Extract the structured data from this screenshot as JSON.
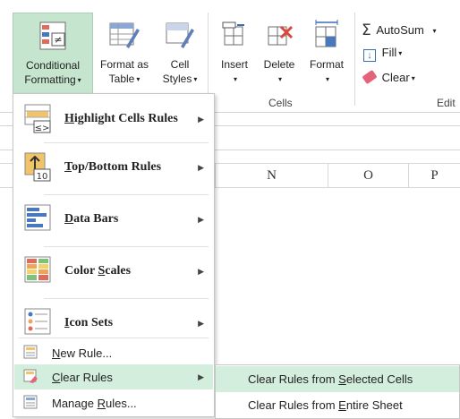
{
  "ribbon": {
    "conditional_formatting": {
      "line1": "Conditional",
      "line2": "Formatting"
    },
    "format_as_table": {
      "line1": "Format as",
      "line2": "Table"
    },
    "cell_styles": {
      "line1": "Cell",
      "line2": "Styles"
    },
    "insert": "Insert",
    "delete": "Delete",
    "format": "Format",
    "cells_group": "Cells",
    "autosum": "AutoSum",
    "fill": "Fill",
    "clear": "Clear",
    "editing_group": "Edit"
  },
  "columns": [
    "N",
    "O",
    "P"
  ],
  "menu": {
    "items": [
      {
        "pre": "",
        "accel": "H",
        "post": "ighlight Cells Rules"
      },
      {
        "pre": "",
        "accel": "T",
        "post": "op/Bottom Rules"
      },
      {
        "pre": "",
        "accel": "D",
        "post": "ata Bars"
      },
      {
        "pre": "Color ",
        "accel": "S",
        "post": "cales"
      },
      {
        "pre": "",
        "accel": "I",
        "post": "con Sets"
      }
    ],
    "new_rule": {
      "pre": "",
      "accel": "N",
      "post": "ew Rule..."
    },
    "clear_rules": {
      "pre": "",
      "accel": "C",
      "post": "lear Rules"
    },
    "manage_rules": {
      "pre": "Manage ",
      "accel": "R",
      "post": "ules..."
    }
  },
  "submenu": {
    "selected_cells": {
      "pre": "Clear Rules from ",
      "accel": "S",
      "post": "elected Cells"
    },
    "entire_sheet": {
      "pre": "Clear Rules from ",
      "accel": "E",
      "post": "ntire Sheet"
    }
  },
  "icons": [
    "conditional-formatting-icon",
    "format-as-table-icon",
    "cell-styles-icon",
    "insert-cells-icon",
    "delete-cells-icon",
    "format-cells-icon",
    "autosum-icon",
    "fill-icon",
    "eraser-icon",
    "highlight-cells-icon",
    "top-bottom-icon",
    "data-bars-icon",
    "color-scales-icon",
    "icon-sets-icon",
    "new-rule-icon",
    "clear-rules-icon",
    "manage-rules-icon"
  ],
  "colors": {
    "active_accent": "#c5e5cf",
    "hover": "#d3eedd",
    "autosum_red": "#d9483b"
  }
}
